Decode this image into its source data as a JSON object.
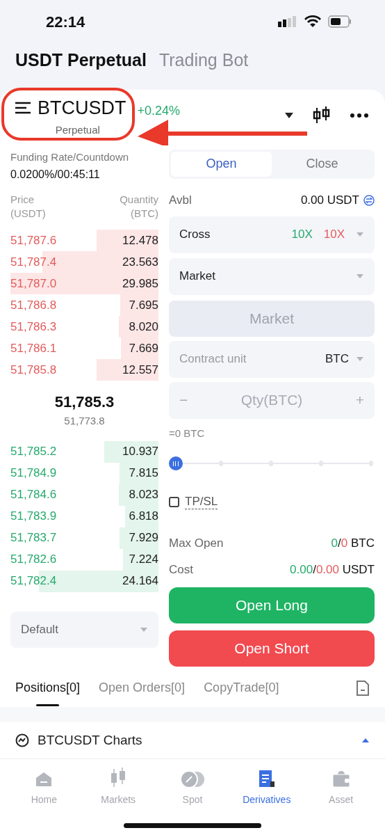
{
  "status_bar": {
    "time": "22:14"
  },
  "top_tabs": [
    {
      "label": "USDT Perpetual",
      "selected": true
    },
    {
      "label": "Trading Bot",
      "selected": false
    }
  ],
  "symbol": {
    "name": "BTCUSDT",
    "type": "Perpetual",
    "change": "+0.24%"
  },
  "funding": {
    "label": "Funding Rate/Countdown",
    "value": "0.0200%/00:45:11"
  },
  "book": {
    "price_header": [
      "Price",
      "(USDT)"
    ],
    "qty_header": [
      "Quantity",
      "(BTC)"
    ],
    "asks": [
      {
        "price": "51,787.6",
        "qty": "12.478"
      },
      {
        "price": "51,787.4",
        "qty": "23.563"
      },
      {
        "price": "51,787.0",
        "qty": "29.985"
      },
      {
        "price": "51,786.8",
        "qty": "7.695"
      },
      {
        "price": "51,786.3",
        "qty": "8.020"
      },
      {
        "price": "51,786.1",
        "qty": "7.669"
      },
      {
        "price": "51,785.8",
        "qty": "12.557"
      }
    ],
    "last_price": "51,785.3",
    "mark_price": "51,773.8",
    "bids": [
      {
        "price": "51,785.2",
        "qty": "10.937"
      },
      {
        "price": "51,784.9",
        "qty": "7.815"
      },
      {
        "price": "51,784.6",
        "qty": "8.023"
      },
      {
        "price": "51,783.9",
        "qty": "6.818"
      },
      {
        "price": "51,783.7",
        "qty": "7.929"
      },
      {
        "price": "51,782.6",
        "qty": "7.224"
      },
      {
        "price": "51,782.4",
        "qty": "24.164"
      }
    ],
    "depth_select": "Default"
  },
  "order_form": {
    "mode_tabs": [
      {
        "label": "Open",
        "selected": true
      },
      {
        "label": "Close",
        "selected": false
      }
    ],
    "avbl_label": "Avbl",
    "avbl_value": "0.00 USDT",
    "margin": {
      "label": "Cross",
      "long": "10X",
      "short": "10X"
    },
    "order_type": "Market",
    "price_field": "Market",
    "contract_unit": {
      "label": "Contract unit",
      "value": "BTC"
    },
    "qty": {
      "minus": "−",
      "placeholder": "Qty(BTC)",
      "plus": "+"
    },
    "qty_equiv": "=0 BTC",
    "slider": {
      "level": 0
    },
    "tpsl": {
      "label": "TP/SL",
      "checked": false
    },
    "max_open": {
      "label": "Max Open",
      "long": "0",
      "sep": "/",
      "short": "0",
      "unit": "BTC"
    },
    "cost": {
      "label": "Cost",
      "long": "0.00",
      "sep": "/",
      "short": "0.00",
      "unit": "USDT"
    },
    "buttons": [
      "Open Long",
      "Open Short"
    ]
  },
  "bottom_tabs": [
    {
      "label": "Positions[0]",
      "selected": true
    },
    {
      "label": "Open Orders[0]",
      "selected": false
    },
    {
      "label": "CopyTrade[0]",
      "selected": false
    }
  ],
  "charts_bar": {
    "label": "BTCUSDT Charts",
    "expanded": false
  },
  "nav": [
    {
      "label": "Home",
      "selected": false
    },
    {
      "label": "Markets",
      "selected": false
    },
    {
      "label": "Spot",
      "selected": false
    },
    {
      "label": "Derivatives",
      "selected": true
    },
    {
      "label": "Asset",
      "selected": false
    }
  ]
}
